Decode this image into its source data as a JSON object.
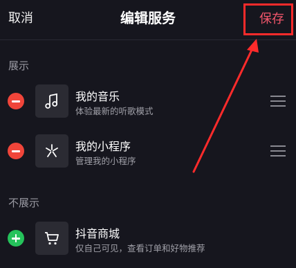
{
  "header": {
    "cancel_label": "取消",
    "title": "编辑服务",
    "save_label": "保存"
  },
  "sections": {
    "shown_label": "展示",
    "hidden_label": "不展示"
  },
  "shown_items": [
    {
      "title": "我的音乐",
      "subtitle": "体验最新的听歌模式",
      "icon": "music-note-icon"
    },
    {
      "title": "我的小程序",
      "subtitle": "管理我的小程序",
      "icon": "mini-program-icon"
    }
  ],
  "hidden_items": [
    {
      "title": "抖音商城",
      "subtitle": "仅自己可见，查看订单和好物推荐",
      "icon": "shopping-cart-icon"
    }
  ],
  "colors": {
    "background": "#16161e",
    "save_accent": "#f2566b",
    "remove": "#f0453a",
    "add": "#25c25b",
    "annotation": "#ff2b2b"
  }
}
